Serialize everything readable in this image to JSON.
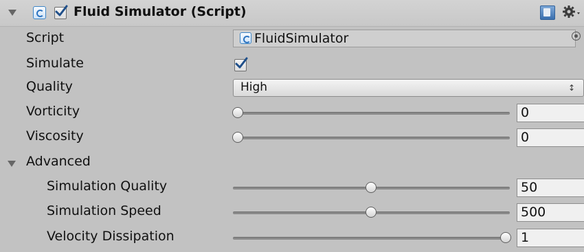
{
  "component": {
    "title": "Fluid Simulator (Script)",
    "enabled": true,
    "expanded": true
  },
  "fields": {
    "script": {
      "label": "Script",
      "value": "FluidSimulator"
    },
    "simulate": {
      "label": "Simulate",
      "checked": true
    },
    "quality": {
      "label": "Quality",
      "value": "High"
    },
    "vorticity": {
      "label": "Vorticity",
      "value": "0",
      "slider_fraction": 0.0
    },
    "viscosity": {
      "label": "Viscosity",
      "value": "0",
      "slider_fraction": 0.0
    }
  },
  "advanced": {
    "label": "Advanced",
    "expanded": true,
    "fields": {
      "simulation_quality": {
        "label": "Simulation Quality",
        "value": "50",
        "slider_fraction": 0.5
      },
      "simulation_speed": {
        "label": "Simulation Speed",
        "value": "500",
        "slider_fraction": 0.5
      },
      "velocity_dissipation": {
        "label": "Velocity Dissipation",
        "value": "1",
        "slider_fraction": 1.0
      }
    }
  },
  "icons": {
    "foldout": "triangle-down-icon",
    "script": "csharp-script-icon",
    "help": "help-book-icon",
    "settings": "gear-icon",
    "picker": "object-picker-icon",
    "dropdown": "dropdown-arrows-icon"
  },
  "colors": {
    "background": "#c2c2c2",
    "check": "#1f4f8a",
    "script_icon": "#3f86c6"
  }
}
